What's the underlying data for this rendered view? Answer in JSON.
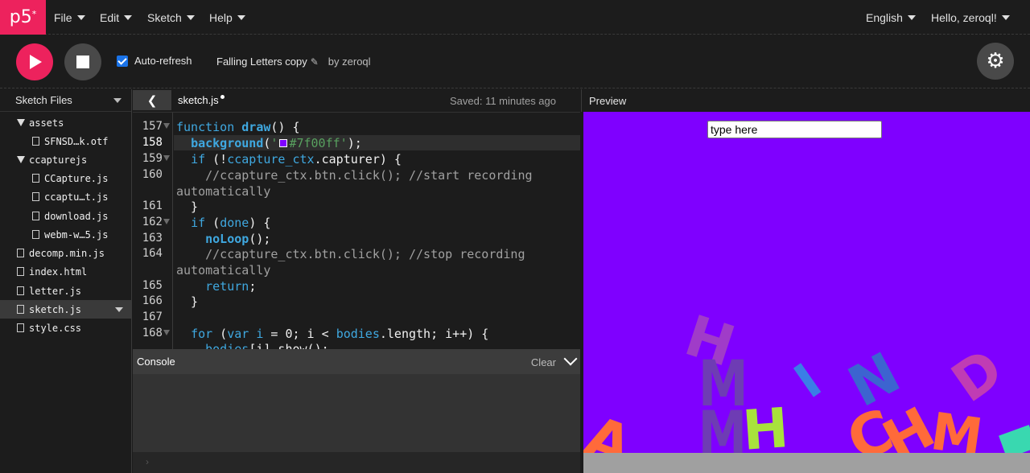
{
  "app": {
    "logo": "p5",
    "logo_mark": "*",
    "menus": [
      "File",
      "Edit",
      "Sketch",
      "Help"
    ],
    "language": "English",
    "greeting": "Hello, zeroql!"
  },
  "toolbar": {
    "autorefresh_label": "Auto-refresh",
    "autorefresh_checked": true,
    "project_name": "Falling Letters copy",
    "by_label": "by zeroql"
  },
  "sidebar": {
    "title": "Sketch Files",
    "items": [
      {
        "label": "assets",
        "type": "folder"
      },
      {
        "label": "SFNSD…k.otf",
        "type": "file"
      },
      {
        "label": "ccapturejs",
        "type": "folder"
      },
      {
        "label": "CCapture.js",
        "type": "file"
      },
      {
        "label": "ccaptu…t.js",
        "type": "file"
      },
      {
        "label": "download.js",
        "type": "file"
      },
      {
        "label": "webm-w…5.js",
        "type": "file"
      },
      {
        "label": "decomp.min.js",
        "type": "file"
      },
      {
        "label": "index.html",
        "type": "file"
      },
      {
        "label": "letter.js",
        "type": "file"
      },
      {
        "label": "sketch.js",
        "type": "file",
        "selected": true
      },
      {
        "label": "style.css",
        "type": "file"
      }
    ]
  },
  "editor": {
    "tab": "sketch.js",
    "saved_status": "Saved: 11 minutes ago",
    "line_numbers": [
      "157",
      "158",
      "159",
      "160",
      "161",
      "162",
      "163",
      "164",
      "165",
      "166",
      "167",
      "168"
    ],
    "code_hex": "'#7f00ff'"
  },
  "console": {
    "title": "Console",
    "clear_label": "Clear",
    "prompt": "›"
  },
  "preview": {
    "title": "Preview",
    "input_value": "type here",
    "background": "#7f00ff",
    "letters": [
      "H",
      "M",
      "M",
      "H",
      "I",
      "N",
      "D",
      "A",
      "C",
      "H",
      "M"
    ]
  },
  "colors": {
    "accent": "#ed225d",
    "canvas": "#7f00ff",
    "keyword": "#3fa8e0",
    "string": "#58a05f"
  }
}
